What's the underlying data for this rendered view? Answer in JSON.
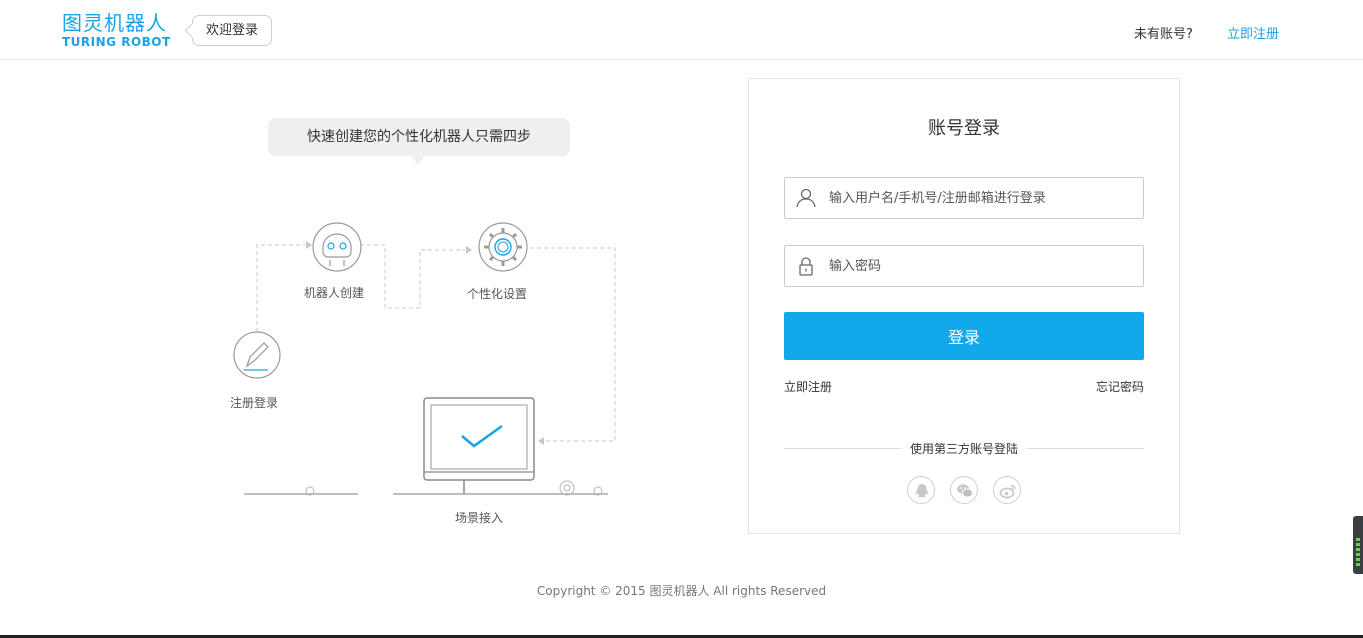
{
  "header": {
    "logo_cn": "图灵机器人",
    "logo_en": "TURING ROBOT",
    "welcome": "欢迎登录",
    "no_account": "未有账号?",
    "register": "立即注册"
  },
  "illustration": {
    "bubble": "快速创建您的个性化机器人只需四步",
    "steps": [
      "注册登录",
      "机器人创建",
      "个性化设置",
      "场景接入"
    ]
  },
  "login": {
    "title": "账号登录",
    "username_placeholder": "输入用户名/手机号/注册邮箱进行登录",
    "password_placeholder": "输入密码",
    "button": "登录",
    "register_link": "立即注册",
    "forgot_link": "忘记密码",
    "third_party": "使用第三方账号登陆"
  },
  "icons": {
    "user": "user-icon",
    "lock": "lock-icon",
    "qq": "qq-icon",
    "wechat": "wechat-icon",
    "weibo": "weibo-icon"
  },
  "colors": {
    "brand": "#1aa3e4",
    "button": "#11a8ec"
  },
  "footer": {
    "copyright": "Copyright © 2015 图灵机器人 All rights Reserved"
  }
}
